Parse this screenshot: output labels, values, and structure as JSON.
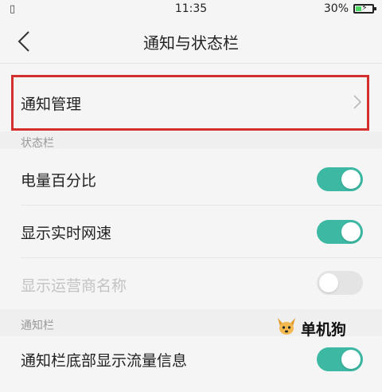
{
  "status_bar": {
    "time": "11:35",
    "battery_percent": "30%",
    "battery_level": 0.3
  },
  "header": {
    "title": "通知与状态栏",
    "back_icon": "chevron-left-icon"
  },
  "rows": {
    "notification_management": {
      "label": "通知管理",
      "icon": "chevron-right-icon"
    },
    "battery_percentage": {
      "label": "电量百分比",
      "toggle": true
    },
    "realtime_speed": {
      "label": "显示实时网速",
      "toggle": true
    },
    "carrier_name": {
      "label": "显示运营商名称",
      "toggle": false,
      "disabled": true
    },
    "bottom_traffic": {
      "label": "通知栏底部显示流量信息",
      "toggle": true
    }
  },
  "sections": {
    "status_bar_title": "状态栏",
    "notification_bar_title": "通知栏"
  },
  "watermark": {
    "text": "单机狗",
    "icon": "dog-logo-icon"
  },
  "colors": {
    "toggle_on": "#3cb8a3",
    "toggle_off": "#e4e4e4",
    "highlight_border": "#d32f2f"
  }
}
